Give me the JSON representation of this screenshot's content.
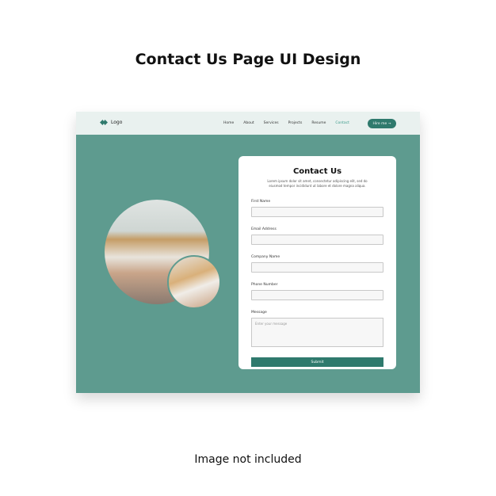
{
  "heading": "Contact Us Page UI Design",
  "footer_note": "Image not included",
  "nav": {
    "logo": "Logo",
    "links": [
      "Home",
      "About",
      "Services",
      "Projects",
      "Resume",
      "Contact"
    ],
    "active": "Contact",
    "hire": "Hire me →"
  },
  "form": {
    "title": "Contact Us",
    "description": "Lorem ipsum dolor sit amet, consectetur adipiscing elit, sed do eiusmod tempor incididunt ut labore et dolore magna aliqua.",
    "fields": [
      "First Name",
      "Email Address",
      "Company Name",
      "Phone Number"
    ],
    "message_label": "Message",
    "message_placeholder": "Enter your message",
    "submit": "Submit"
  },
  "colors": {
    "accent": "#2f7a6d",
    "background": "#5e9b8f"
  }
}
